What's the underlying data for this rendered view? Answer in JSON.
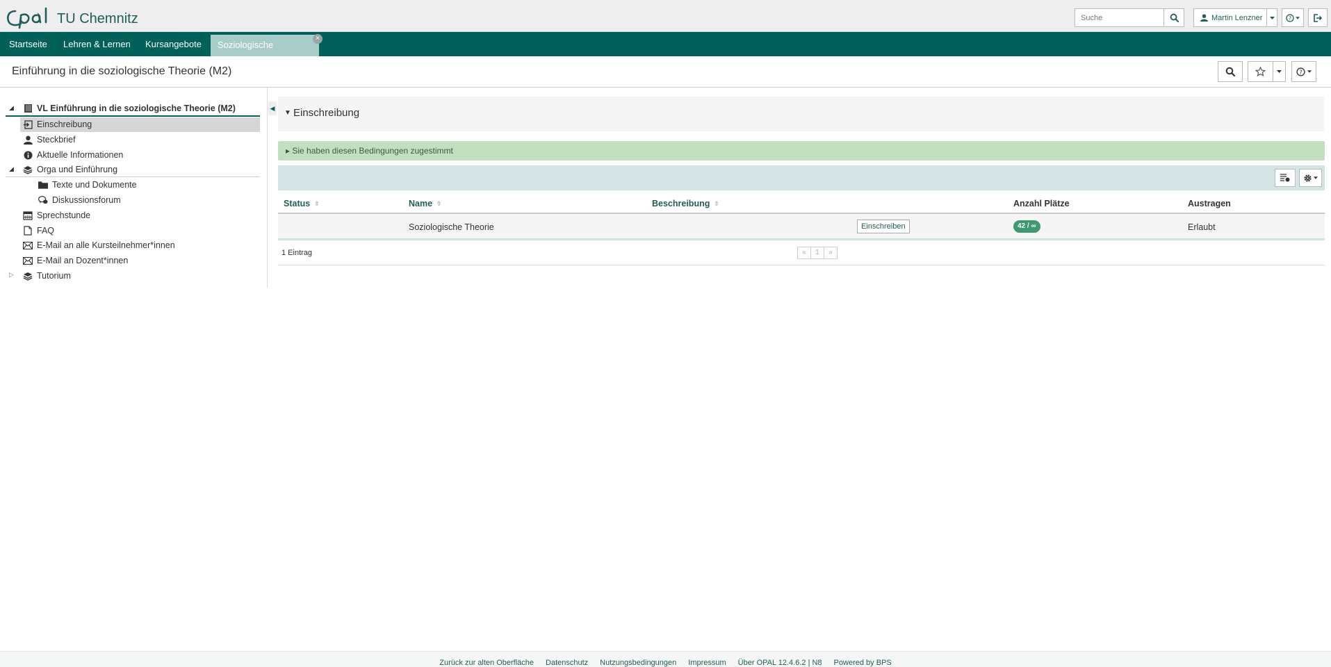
{
  "header": {
    "brand": "TU Chemnitz",
    "search_placeholder": "Suche",
    "user_name": "Martin Lenzner"
  },
  "nav": {
    "tabs": [
      {
        "label": "Startseite"
      },
      {
        "label": "Lehren & Lernen"
      },
      {
        "label": "Kursangebote"
      },
      {
        "label": "Soziologische Klassike..."
      }
    ],
    "close_glyph": "×"
  },
  "course": {
    "title": "Einführung in die soziologische Theorie (M2)"
  },
  "tree": {
    "root": "VL Einführung in die soziologische Theorie (M2)",
    "items": [
      {
        "label": "Einschreibung",
        "icon": "enroll-icon"
      },
      {
        "label": "Steckbrief",
        "icon": "person-icon"
      },
      {
        "label": "Aktuelle Informationen",
        "icon": "info-icon"
      },
      {
        "label": "Orga und Einführung",
        "icon": "layers-icon"
      },
      {
        "label": "Texte und Dokumente",
        "icon": "folder-icon"
      },
      {
        "label": "Diskussionsforum",
        "icon": "forum-icon"
      },
      {
        "label": "Sprechstunde",
        "icon": "calendar-icon"
      },
      {
        "label": "FAQ",
        "icon": "page-icon"
      },
      {
        "label": "E-Mail an alle Kursteilnehmer*innen",
        "icon": "mail-icon"
      },
      {
        "label": "E-Mail an Dozent*innen",
        "icon": "mail-icon"
      },
      {
        "label": "Tutorium",
        "icon": "layers-icon"
      }
    ]
  },
  "panel": {
    "title": "Einschreibung",
    "notice": "▸ Sie haben diesen Bedingungen zugestimmt"
  },
  "table": {
    "headers": [
      "Status",
      "Name",
      "Beschreibung",
      "Anzahl Plätze",
      "Austragen"
    ],
    "rows": [
      {
        "status": "",
        "name": "Soziologische Theorie",
        "description": "",
        "action": "Einschreiben",
        "places": "42 / ∞",
        "unenroll": "Erlaubt"
      }
    ],
    "entry_count": "1 Eintrag",
    "pager": [
      "«",
      "1",
      "»"
    ]
  },
  "footer": {
    "links": [
      "Zurück zur alten Oberfläche",
      "Datenschutz",
      "Nutzungsbedingungen",
      "Impressum",
      "Über OPAL 12.4.6.2 | N8",
      "Powered by BPS"
    ]
  },
  "colors": {
    "primary": "#00605a",
    "active_tab": "#a8ccc8",
    "notice_bg": "#c2dfc0",
    "toolbar_bg": "#d4e4e4",
    "badge": "#3d9a6f"
  }
}
